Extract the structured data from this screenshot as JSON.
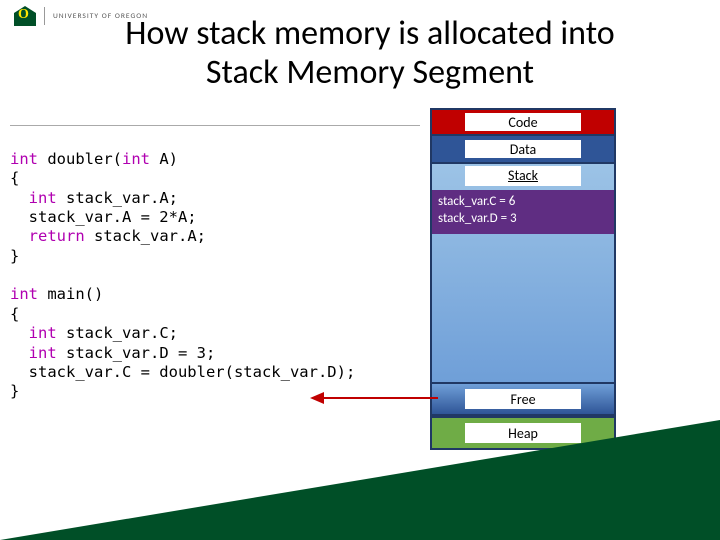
{
  "header": {
    "org": "UNIVERSITY OF OREGON",
    "title_line1": "How stack memory is allocated into",
    "title_line2": "Stack Memory Segment"
  },
  "code": {
    "l1": "int doubler(int A)",
    "l2": "{",
    "l3": "  int stack_var.A;",
    "l4": "  stack_var.A = 2*A;",
    "l5": "  return stack_var.A;",
    "l6": "}",
    "l7": "",
    "l8": "int main()",
    "l9": "{",
    "l10": "  int stack_var.C;",
    "l11": "  int stack_var.D = 3;",
    "l12": "  stack_var.C = doubler(stack_var.D);",
    "l13": "}"
  },
  "segments": {
    "code": "Code",
    "data": "Data",
    "stack": "Stack",
    "stack_vars": {
      "line1": "stack_var.C = 6",
      "line2": "stack_var.D = 3"
    },
    "free": "Free",
    "heap": "Heap"
  },
  "chart_data": {
    "type": "table",
    "title": "Process memory segments",
    "segments": [
      "Code",
      "Data",
      "Stack",
      "Free",
      "Heap"
    ],
    "stack_frames": [
      {
        "frame": "main",
        "variables": {
          "stack_var.C": 6,
          "stack_var.D": 3
        }
      }
    ]
  }
}
